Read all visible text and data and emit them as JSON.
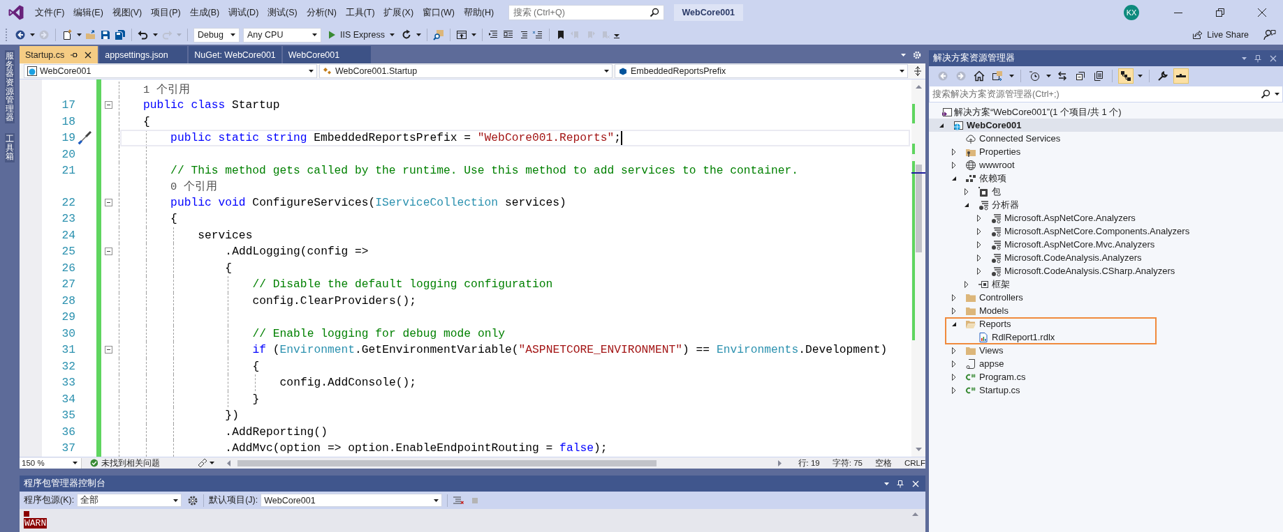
{
  "menu_bar": {
    "items": [
      "文件(F)",
      "编辑(E)",
      "视图(V)",
      "项目(P)",
      "生成(B)",
      "调试(D)",
      "测试(S)",
      "分析(N)",
      "工具(T)",
      "扩展(X)",
      "窗口(W)",
      "帮助(H)"
    ],
    "search": {
      "placeholder": "搜索 (Ctrl+Q)"
    },
    "solution_name": "WebCore001",
    "account": {
      "initials": "KX"
    }
  },
  "toolbar": {
    "items": [
      {
        "kind": "back",
        "disabled": false
      },
      {
        "kind": "forward",
        "disabled": true
      },
      {
        "kind": "new-item",
        "disabled": false
      },
      {
        "kind": "open",
        "disabled": false
      },
      {
        "kind": "save",
        "disabled": false
      },
      {
        "kind": "save-all",
        "disabled": false
      },
      {
        "kind": "undo",
        "disabled": false
      },
      {
        "kind": "redo",
        "disabled": true
      },
      {
        "kind": "dropdown",
        "text": "Debug",
        "disabled": false
      },
      {
        "kind": "dropdown",
        "text": "Any CPU",
        "disabled": false
      },
      {
        "kind": "run",
        "text": "IIS Express",
        "disabled": false
      },
      {
        "kind": "refresh",
        "disabled": false
      },
      {
        "kind": "find",
        "disabled": false
      },
      {
        "kind": "browser",
        "disabled": false
      },
      {
        "kind": "outdent",
        "disabled": false
      },
      {
        "kind": "indent",
        "disabled": false
      },
      {
        "kind": "comment",
        "disabled": false
      },
      {
        "kind": "uncomment",
        "disabled": false
      },
      {
        "kind": "bookmark",
        "disabled": false
      },
      {
        "kind": "bookmark-prev",
        "disabled": true
      },
      {
        "kind": "bookmark-next",
        "disabled": true
      },
      {
        "kind": "bookmark-clear",
        "disabled": true
      }
    ],
    "live_share": "Live Share"
  },
  "side_tabs": [
    "服务器资源管理器",
    "工具箱"
  ],
  "document_tabs": [
    {
      "label": "Startup.cs",
      "selected": true
    },
    {
      "label": "appsettings.json",
      "selected": false
    },
    {
      "label": "NuGet: WebCore001",
      "selected": false
    },
    {
      "label": "WebCore001",
      "selected": false
    }
  ],
  "navigation_bar": {
    "project": "WebCore001",
    "type": "WebCore001.Startup",
    "member": "EmbeddedReportsPrefix"
  },
  "editor": {
    "lines": [
      {
        "kind": "codelens",
        "text": "1 个引用"
      },
      {
        "kind": "code",
        "number": "17",
        "fold": true,
        "current": false,
        "segments": [
          {
            "kind": "keyword",
            "text": "public class"
          },
          {
            "kind": "plain",
            "text": " Startup"
          }
        ]
      },
      {
        "kind": "code",
        "number": "18",
        "fold": false,
        "current": false,
        "segments": [
          {
            "kind": "plain",
            "text": "{"
          }
        ]
      },
      {
        "kind": "code",
        "number": "19",
        "fold": false,
        "current": true,
        "quick_action": true,
        "segments": [
          {
            "kind": "keyword",
            "text": "    public static string"
          },
          {
            "kind": "plain",
            "text": " EmbeddedReportsPrefix = "
          },
          {
            "kind": "string",
            "text": "\"WebCore001.Reports\""
          },
          {
            "kind": "plain",
            "text": ";"
          }
        ]
      },
      {
        "kind": "code",
        "number": "20",
        "fold": false,
        "current": false
      },
      {
        "kind": "code",
        "number": "21",
        "fold": false,
        "current": false,
        "segments": [
          {
            "kind": "comment",
            "text": "    // This method gets called by the runtime. Use this method to add services to the container."
          }
        ]
      },
      {
        "kind": "codelens",
        "text": "    0 个引用"
      },
      {
        "kind": "code",
        "number": "22",
        "fold": true,
        "current": false,
        "segments": [
          {
            "kind": "keyword",
            "text": "    public void"
          },
          {
            "kind": "plain",
            "text": " ConfigureServices("
          },
          {
            "kind": "type",
            "text": "IServiceCollection"
          },
          {
            "kind": "plain",
            "text": " services)"
          }
        ]
      },
      {
        "kind": "code",
        "number": "23",
        "fold": false,
        "current": false,
        "segments": [
          {
            "kind": "plain",
            "text": "    {"
          }
        ]
      },
      {
        "kind": "code",
        "number": "24",
        "fold": false,
        "current": false,
        "segments": [
          {
            "kind": "plain",
            "text": "        services"
          }
        ]
      },
      {
        "kind": "code",
        "number": "25",
        "fold": true,
        "current": false,
        "segments": [
          {
            "kind": "plain",
            "text": "            .AddLogging(config =>"
          }
        ]
      },
      {
        "kind": "code",
        "number": "26",
        "fold": false,
        "current": false,
        "segments": [
          {
            "kind": "plain",
            "text": "            {"
          }
        ]
      },
      {
        "kind": "code",
        "number": "27",
        "fold": false,
        "current": false,
        "segments": [
          {
            "kind": "comment",
            "text": "                // Disable the default logging configuration"
          }
        ]
      },
      {
        "kind": "code",
        "number": "28",
        "fold": false,
        "current": false,
        "segments": [
          {
            "kind": "plain",
            "text": "                config.ClearProviders();"
          }
        ]
      },
      {
        "kind": "code",
        "number": "29",
        "fold": false,
        "current": false
      },
      {
        "kind": "code",
        "number": "30",
        "fold": false,
        "current": false,
        "segments": [
          {
            "kind": "comment",
            "text": "                // Enable logging for debug mode only"
          }
        ]
      },
      {
        "kind": "code",
        "number": "31",
        "fold": true,
        "current": false,
        "segments": [
          {
            "kind": "keyword",
            "text": "                if"
          },
          {
            "kind": "plain",
            "text": " ("
          },
          {
            "kind": "type",
            "text": "Environment"
          },
          {
            "kind": "plain",
            "text": ".GetEnvironmentVariable("
          },
          {
            "kind": "string",
            "text": "\"ASPNETCORE_ENVIRONMENT\""
          },
          {
            "kind": "plain",
            "text": ") == "
          },
          {
            "kind": "type",
            "text": "Environments"
          },
          {
            "kind": "plain",
            "text": ".Development)"
          }
        ]
      },
      {
        "kind": "code",
        "number": "32",
        "fold": false,
        "current": false,
        "segments": [
          {
            "kind": "plain",
            "text": "                {"
          }
        ]
      },
      {
        "kind": "code",
        "number": "33",
        "fold": false,
        "current": false,
        "segments": [
          {
            "kind": "plain",
            "text": "                    config.AddConsole();"
          }
        ]
      },
      {
        "kind": "code",
        "number": "34",
        "fold": false,
        "current": false,
        "segments": [
          {
            "kind": "plain",
            "text": "                }"
          }
        ]
      },
      {
        "kind": "code",
        "number": "35",
        "fold": false,
        "current": false,
        "segments": [
          {
            "kind": "plain",
            "text": "            })"
          }
        ]
      },
      {
        "kind": "code",
        "number": "36",
        "fold": false,
        "current": false,
        "segments": [
          {
            "kind": "plain",
            "text": "            .AddReporting()"
          }
        ]
      },
      {
        "kind": "code",
        "number": "37",
        "fold": false,
        "current": false,
        "segments": [
          {
            "kind": "plain",
            "text": "            .AddMvc(option => option.EnableEndpointRouting = "
          },
          {
            "kind": "keyword",
            "text": "false"
          },
          {
            "kind": "plain",
            "text": ");"
          }
        ]
      }
    ],
    "status": {
      "zoom": "150 %",
      "issues": "未找到相关问题",
      "line": "行: 19",
      "column": "字符: 75",
      "whitespace": "空格",
      "line_ending": "CRLF"
    }
  },
  "package_console": {
    "title": "程序包管理器控制台",
    "source_label": "程序包源(K):",
    "source": "全部",
    "project_label": "默认项目(J):",
    "project": "WebCore001",
    "output": "WARN"
  },
  "solution_explorer": {
    "title": "解决方案资源管理器",
    "toolbar": [
      {
        "kind": "back",
        "on": false,
        "disabled": true
      },
      {
        "kind": "forward",
        "on": false,
        "disabled": true
      },
      {
        "kind": "home",
        "on": false,
        "disabled": false
      },
      {
        "kind": "sync",
        "on": false,
        "disabled": false
      },
      {
        "kind": "history",
        "on": false,
        "disabled": false
      },
      {
        "kind": "swap",
        "on": false,
        "disabled": false
      },
      {
        "kind": "collapse",
        "on": false,
        "disabled": false
      },
      {
        "kind": "copy",
        "on": false,
        "disabled": false
      },
      {
        "kind": "show-all",
        "on": true,
        "disabled": false
      },
      {
        "kind": "properties",
        "on": false,
        "disabled": false
      },
      {
        "kind": "preview",
        "on": true,
        "disabled": false
      }
    ],
    "search": {
      "placeholder": "搜索解决方案资源管理器(Ctrl+;)"
    },
    "solution": "解决方案“WebCore001”(1 个项目/共 1 个)",
    "tree": [
      {
        "label": "WebCore001",
        "kind": "project",
        "expanded": true,
        "selected": true,
        "children": [
          {
            "label": "Connected Services",
            "kind": "cloud",
            "selected": false
          },
          {
            "label": "Properties",
            "kind": "properties",
            "expanded": false,
            "selected": false
          },
          {
            "label": "wwwroot",
            "kind": "globe",
            "expanded": false,
            "selected": false
          },
          {
            "label": "依赖项",
            "kind": "dependencies",
            "expanded": true,
            "selected": false,
            "children": [
              {
                "label": "包",
                "kind": "package",
                "expanded": false,
                "selected": false
              },
              {
                "label": "分析器",
                "kind": "analyzer",
                "expanded": true,
                "selected": false,
                "children": [
                  {
                    "label": "Microsoft.AspNetCore.Analyzers",
                    "kind": "analyzer",
                    "expanded": false,
                    "selected": false
                  },
                  {
                    "label": "Microsoft.AspNetCore.Components.Analyzers",
                    "kind": "analyzer",
                    "expanded": false,
                    "selected": false
                  },
                  {
                    "label": "Microsoft.AspNetCore.Mvc.Analyzers",
                    "kind": "analyzer",
                    "expanded": false,
                    "selected": false
                  },
                  {
                    "label": "Microsoft.CodeAnalysis.Analyzers",
                    "kind": "analyzer",
                    "expanded": false,
                    "selected": false
                  },
                  {
                    "label": "Microsoft.CodeAnalysis.CSharp.Analyzers",
                    "kind": "analyzer",
                    "expanded": false,
                    "selected": false
                  }
                ]
              },
              {
                "label": "框架",
                "kind": "framework",
                "expanded": false,
                "selected": false
              }
            ]
          },
          {
            "label": "Controllers",
            "kind": "folder",
            "expanded": false,
            "selected": false
          },
          {
            "label": "Models",
            "kind": "folder",
            "expanded": false,
            "selected": false
          },
          {
            "label": "Reports",
            "kind": "folder",
            "expanded": true,
            "selected": false,
            "highlighted": true,
            "children": [
              {
                "label": "RdlReport1.rdlx",
                "kind": "report",
                "selected": false
              }
            ]
          },
          {
            "label": "Views",
            "kind": "folder",
            "expanded": false,
            "selected": false
          },
          {
            "label": "appse",
            "kind": "json",
            "expanded": false,
            "selected": false
          },
          {
            "label": "Program.cs",
            "kind": "csharp",
            "expanded": false,
            "selected": false
          },
          {
            "label": "Startup.cs",
            "kind": "csharp",
            "expanded": false,
            "selected": false
          }
        ]
      }
    ]
  }
}
